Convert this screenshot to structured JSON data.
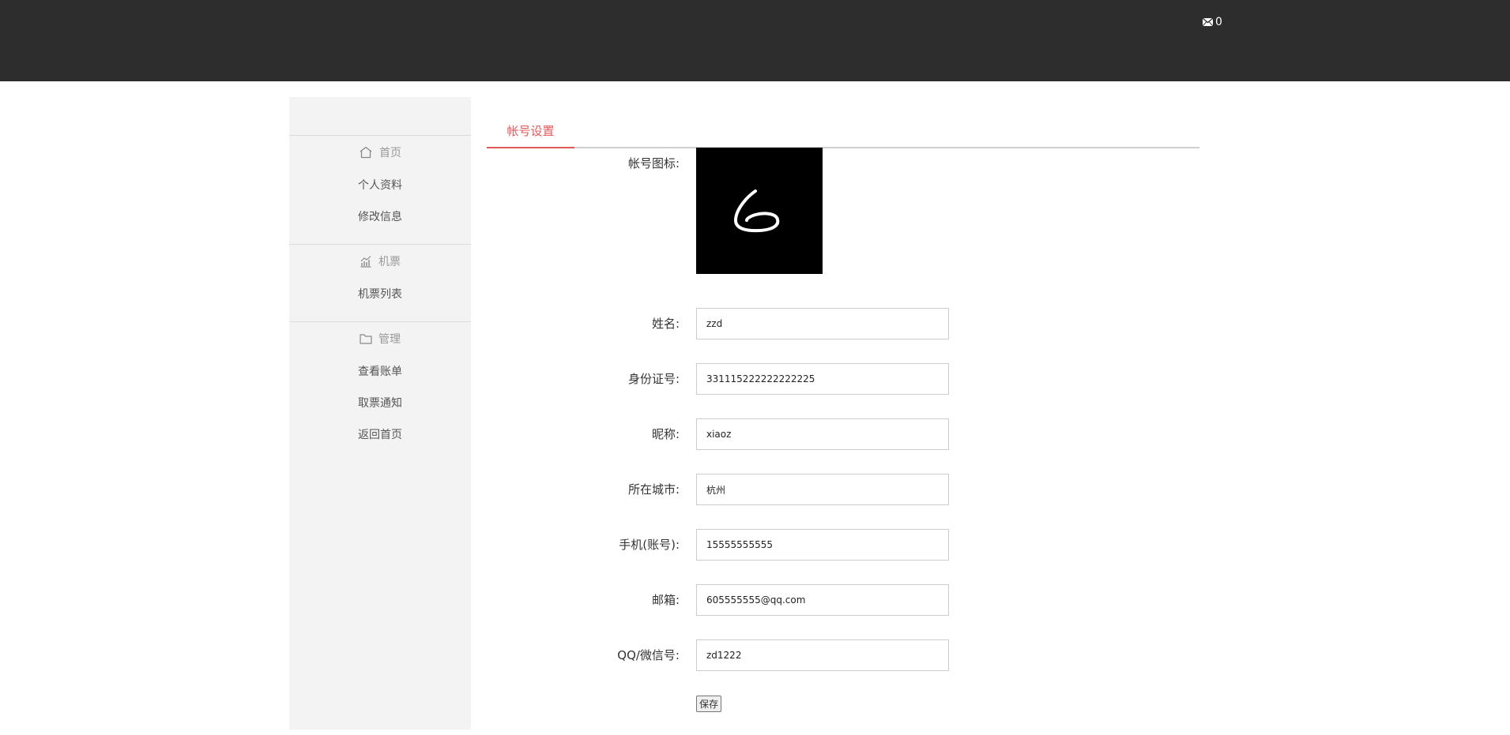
{
  "header": {
    "mail_icon": "envelope-icon",
    "mail_count": "0"
  },
  "sidebar": {
    "groups": [
      {
        "title": "首页",
        "icon": "home-icon",
        "items": [
          "个人资料",
          "修改信息"
        ]
      },
      {
        "title": "机票",
        "icon": "chart-icon",
        "items": [
          "机票列表"
        ]
      },
      {
        "title": "管理",
        "icon": "folder-icon",
        "items": [
          "查看账单",
          "取票通知",
          "返回首页"
        ]
      }
    ]
  },
  "tabs": {
    "active": "帐号设置"
  },
  "form": {
    "avatar_label": "帐号图标:",
    "name_label": "姓名:",
    "name_value": "zzd",
    "id_label": "身份证号:",
    "id_value": "331115222222222225",
    "nickname_label": "昵称:",
    "nickname_value": "xiaoz",
    "city_label": "所在城市:",
    "city_value": "杭州",
    "phone_label": "手机(账号):",
    "phone_value": "15555555555",
    "email_label": "邮箱:",
    "email_value": "605555555@qq.com",
    "qq_label": "QQ/微信号:",
    "qq_value": "zd1222",
    "save_label": "保存"
  }
}
